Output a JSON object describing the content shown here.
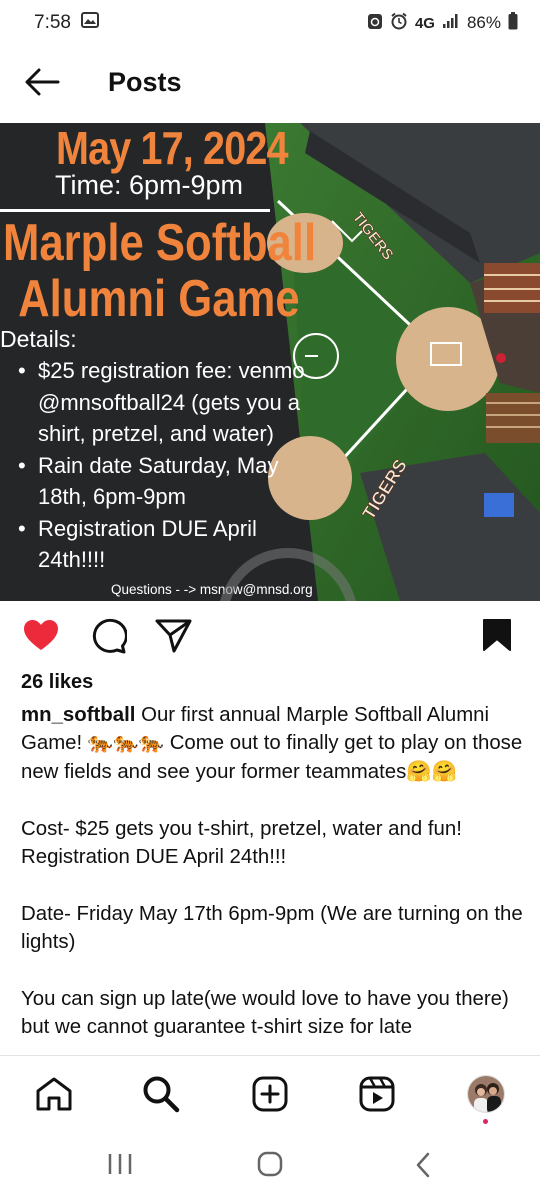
{
  "status_bar": {
    "time": "7:58",
    "network": "4G",
    "battery": "86%"
  },
  "header": {
    "title": "Posts"
  },
  "flyer": {
    "date": "May 17, 2024",
    "time": "Time: 6pm-9pm",
    "title_line1": "Marple Softball",
    "title_line2": "Alumni Game",
    "details_label": "Details:",
    "items": [
      "$25 registration fee: venmo @mnsoftball24 (gets you a shirt, pretzel, and water)",
      "Rain date Saturday, May 18th, 6pm-9pm",
      "Registration DUE April 24th!!!!"
    ],
    "questions": "Questions - -> msnow@mnsd.org",
    "field_text": "TIGERS"
  },
  "post": {
    "likes": "26 likes",
    "username": "mn_softball",
    "caption_intro": "Our first annual Marple Softball Alumni Game! 🐅🐅🐅 Come out to finally get to play on those new fields and see your former teammates🤗🤗",
    "caption_cost": "Cost- $25 gets you t-shirt, pretzel, water and fun! Registration DUE April 24th!!!",
    "caption_date": "Date- Friday May 17th 6pm-9pm (We are turning on the lights)",
    "caption_late": "You can sign up late(we would love to have you there) but we cannot guarantee t-shirt size for late"
  },
  "colors": {
    "accent_orange": "#f0843c",
    "like_red": "#ed2a3c",
    "field_green": "#2f6b2a",
    "dirt": "#d8b48c"
  }
}
